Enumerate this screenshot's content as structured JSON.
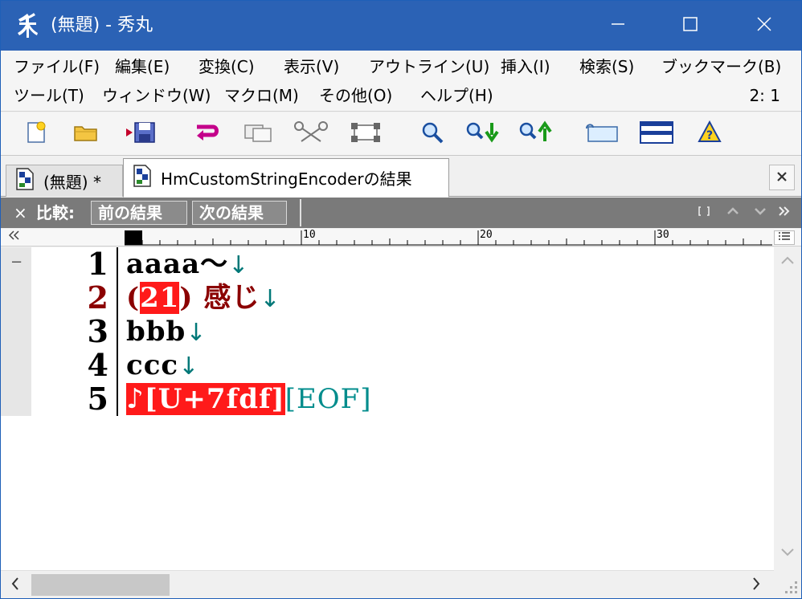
{
  "window": {
    "title": "(無題) - 秀丸",
    "app_icon": "hidemaru-logo-icon"
  },
  "caption_buttons": {
    "minimize": "minimize-icon",
    "maximize": "maximize-icon",
    "close": "close-icon"
  },
  "menu": {
    "row1": [
      "ファイル(F)",
      "編集(E)",
      "変換(C)",
      "表示(V)",
      "アウトライン(U)",
      "挿入(I)",
      "検索(S)",
      "ブックマーク(B)"
    ],
    "row2": [
      "ツール(T)",
      "ウィンドウ(W)",
      "マクロ(M)",
      "その他(O)",
      "ヘルプ(H)"
    ],
    "cursor_position": "2: 1"
  },
  "toolbar": {
    "icons": [
      "new-file-icon",
      "open-folder-icon",
      "save-icon",
      "undo-icon",
      "copy-icon",
      "cut-icon",
      "paste-icon",
      "search-icon",
      "search-next-icon",
      "search-prev-icon",
      "tag-jump-icon",
      "window-split-icon",
      "help-icon"
    ]
  },
  "tabs": [
    {
      "label": "(無題) *",
      "active": false
    },
    {
      "label": "HmCustomStringEncoderの結果",
      "active": true
    }
  ],
  "compare_bar": {
    "close": "×",
    "label": "比較:",
    "prev_button": "前の結果",
    "next_button": "次の結果"
  },
  "ruler": {
    "marks": [
      "10",
      "20",
      "30"
    ]
  },
  "editor": {
    "line_numbers": [
      "1",
      "2",
      "3",
      "4",
      "5"
    ],
    "lines": {
      "l1_text": "aaaa～",
      "l2_open": " (",
      "l2_highlight": "21",
      "l2_rest": ") 感じ",
      "l3_text": "bbb",
      "l4_text": "ccc",
      "l5_highlight": "♪[U+7fdf]",
      "eof": "[EOF]"
    },
    "newline_mark": "↓",
    "fold_mark": "−"
  },
  "colors": {
    "titlebar": "#2b62b5",
    "changed_line": "#8b0000",
    "highlight": "#ff1a1a",
    "newline": "#007878",
    "eof": "#008c8c"
  }
}
